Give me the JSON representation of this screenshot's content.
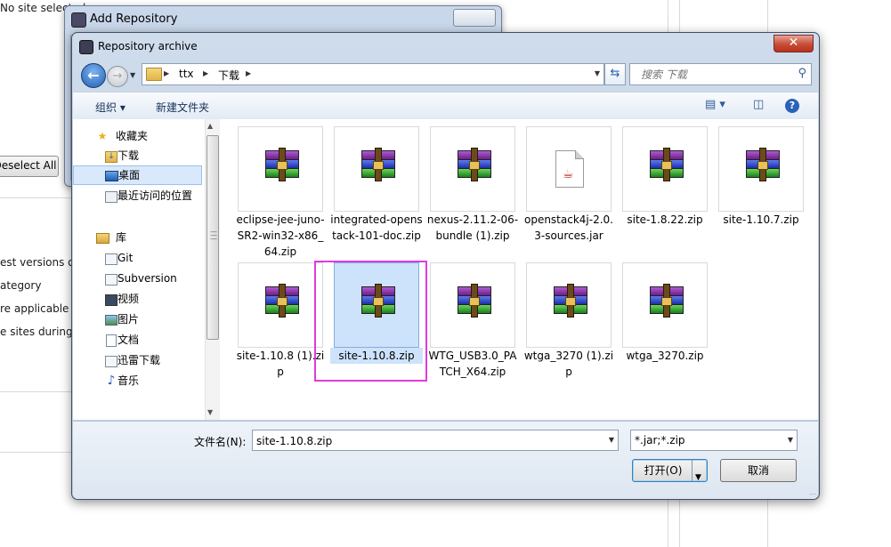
{
  "background": {
    "top_text": "No site selected.",
    "deselect_all": "Deselect All",
    "option_texts": [
      "est versions of",
      "ategory",
      "re applicable t",
      "e sites during i"
    ]
  },
  "add_repository": {
    "title": "Add Repository"
  },
  "dialog": {
    "title": "Repository archive",
    "close_glyph": "✕",
    "address": {
      "segments": [
        "ttx",
        "下载"
      ]
    },
    "search_placeholder": "搜索 下载",
    "toolbar": {
      "organize": "组织 ▾",
      "new_folder": "新建文件夹"
    },
    "nav": {
      "favorites_header": "收藏夹",
      "favorites": [
        "下载",
        "桌面",
        "最近访问的位置"
      ],
      "libraries_header": "库",
      "libraries": [
        "Git",
        "Subversion",
        "视频",
        "图片",
        "文档",
        "迅雷下载",
        "音乐"
      ],
      "selected": "桌面"
    },
    "files": [
      {
        "name": "eclipse-jee-juno-SR2-win32-x86_64.zip",
        "type": "rar"
      },
      {
        "name": "integrated-openstack-101-doc.zip",
        "type": "rar"
      },
      {
        "name": "nexus-2.11.2-06-bundle (1).zip",
        "type": "rar"
      },
      {
        "name": "openstack4j-2.0.3-sources.jar",
        "type": "jar"
      },
      {
        "name": "site-1.8.22.zip",
        "type": "rar"
      },
      {
        "name": "site-1.10.7.zip",
        "type": "rar"
      },
      {
        "name": "site-1.10.8 (1).zip",
        "type": "rar"
      },
      {
        "name": "site-1.10.8.zip",
        "type": "rar",
        "selected": true
      },
      {
        "name": "WTG_USB3.0_PATCH_X64.zip",
        "type": "rar"
      },
      {
        "name": "wtga_3270 (1).zip",
        "type": "rar"
      },
      {
        "name": "wtga_3270.zip",
        "type": "rar"
      }
    ],
    "footer": {
      "filename_label": "文件名(N):",
      "filename_value": "site-1.10.8.zip",
      "filetype": "*.jar;*.zip",
      "open": "打开(O)",
      "cancel": "取消"
    }
  },
  "colors": {
    "selection_fill": "#cde3fb",
    "highlight_border": "#e03be0",
    "title_bar": "#c9d7ea",
    "close_button": "#c74d36"
  }
}
